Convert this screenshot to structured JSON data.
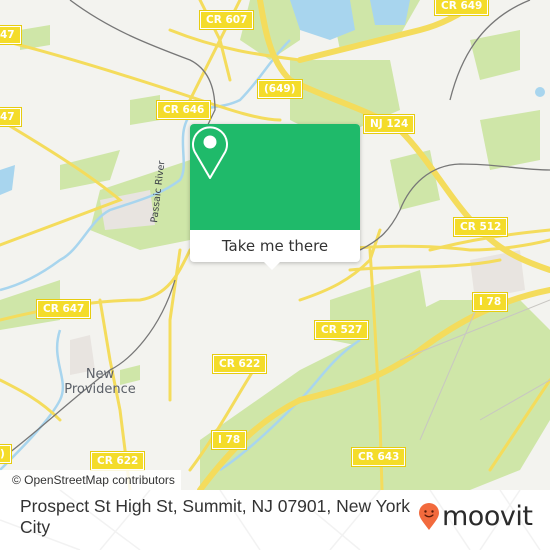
{
  "map": {
    "road_shields": [
      {
        "id": "cr607",
        "label": "CR 607"
      },
      {
        "id": "cr649-top",
        "label": "CR 649"
      },
      {
        "id": "cr649-paren",
        "label": "(649)"
      },
      {
        "id": "cr646",
        "label": "CR 646"
      },
      {
        "id": "nj124",
        "label": "NJ 124"
      },
      {
        "id": "cr512",
        "label": "CR 512"
      },
      {
        "id": "i78-right",
        "label": "I 78"
      },
      {
        "id": "cr647-left",
        "label": "47"
      },
      {
        "id": "cr647-top-left",
        "label": "47"
      },
      {
        "id": "cr647",
        "label": "CR 647"
      },
      {
        "id": "cr527",
        "label": "CR 527"
      },
      {
        "id": "cr622",
        "label": "CR 622"
      },
      {
        "id": "i78-mid",
        "label": "I 78"
      },
      {
        "id": "cr622-bottom",
        "label": "CR 622"
      },
      {
        "id": "cr643",
        "label": "CR 643"
      },
      {
        "id": "paren-bottom-left",
        "label": ")"
      }
    ],
    "place_label": "New Providence",
    "river_label": "Passaic River",
    "attribution": "© OpenStreetMap contributors",
    "colors": {
      "land": "#f3f3ef",
      "park": "#cfe6a8",
      "water": "#a8d5ee",
      "road": "#f4dc5c",
      "rail": "#777777",
      "shield": "#f4dc2a"
    }
  },
  "popup": {
    "icon": "map-pin-icon",
    "button_label": "Take me there",
    "accent": "#1fba6a"
  },
  "footer": {
    "address": "Prospect St High St, Summit, NJ 07901, New York City",
    "brand": "moovit",
    "brand_color": "#f26a3d"
  }
}
